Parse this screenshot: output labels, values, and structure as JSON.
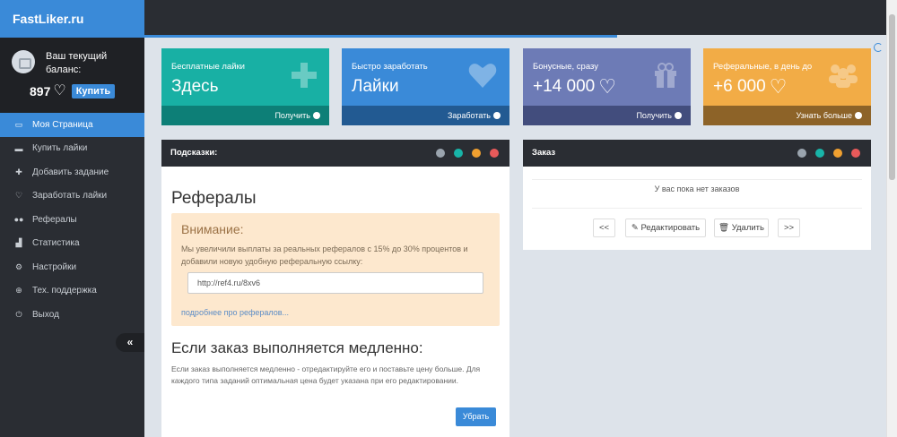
{
  "brand": "FastLiker.ru",
  "user": {
    "balance_title": "Ваш текущий баланс:",
    "balance": "897",
    "buy_label": "Купить"
  },
  "menu": [
    {
      "label": "Моя Страница",
      "icon": "laptop-icon",
      "active": true
    },
    {
      "label": "Купить лайки",
      "icon": "card-icon"
    },
    {
      "label": "Добавить задание",
      "icon": "plus-icon"
    },
    {
      "label": "Заработать лайки",
      "icon": "heart-icon"
    },
    {
      "label": "Рефералы",
      "icon": "users-icon"
    },
    {
      "label": "Статистика",
      "icon": "chart-icon"
    },
    {
      "label": "Настройки",
      "icon": "gears-icon"
    },
    {
      "label": "Тех. поддержка",
      "icon": "globe-icon"
    },
    {
      "label": "Выход",
      "icon": "power-icon"
    }
  ],
  "cards": [
    {
      "title": "Бесплатные лайки",
      "value": "Здесь",
      "footer": "Получить",
      "color": "#18b0a4",
      "footer_color": "#0d7f77",
      "icon": "plus-icon"
    },
    {
      "title": "Быстро заработать",
      "value": "Лайки",
      "footer": "Заработать",
      "color": "#3a8ad8",
      "footer_color": "#225a92",
      "icon": "heart-icon"
    },
    {
      "title": "Бонусные, сразу",
      "value": "+14 000",
      "footer": "Получить",
      "color": "#6d7bb6",
      "footer_color": "#424d7d",
      "icon": "gift-icon"
    },
    {
      "title": "Реферальные, в день до",
      "value": "+6 000",
      "footer": "Узнать больше",
      "color": "#f2ac46",
      "footer_color": "#8d6328",
      "icon": "users-icon"
    }
  ],
  "tips_panel": {
    "header": "Подсказки:",
    "ref_title": "Рефералы",
    "alert_title": "Внимание:",
    "alert_text": "Мы увеличили выплаты за реальных рефералов с 15% до 30% процентов и добавили новую удобную реферальную ссылку:",
    "ref_link": "http://ref4.ru/8xv6",
    "alert_link": "подробнее про рефералов...",
    "slow_title": "Если заказ выполняется медленно:",
    "slow_text": "Если заказ выполняется медленно - отредактируйте его и поставьте цену больше. Для каждого типа заданий оптимальная цена будет указана при его редактировании.",
    "hide_label": "Убрать"
  },
  "order_panel": {
    "header": "Заказ",
    "empty_text": "У вас пока нет заказов",
    "prev_label": "<<",
    "edit_label": "Редактировать",
    "delete_label": "Удалить",
    "next_label": ">>"
  }
}
